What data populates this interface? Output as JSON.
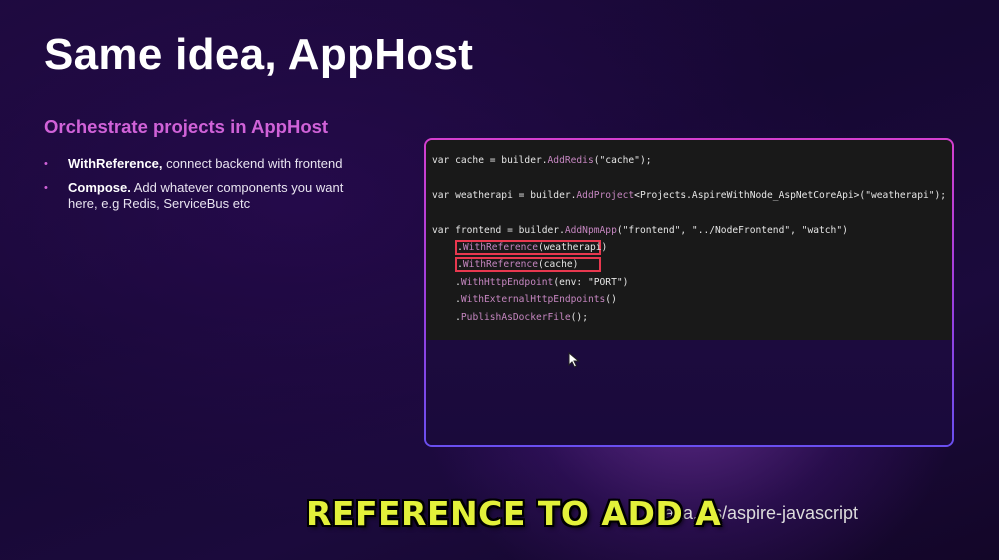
{
  "slide": {
    "title": "Same idea, AppHost",
    "subtitle": "Orchestrate projects in AppHost",
    "bullets": [
      {
        "bold": "WithReference,",
        "text": " connect backend with frontend"
      },
      {
        "bold": "Compose.",
        "text": " Add whatever components you want here, e.g Redis, ServiceBus etc"
      }
    ]
  },
  "code": {
    "lines": [
      [
        "var cache = builder.",
        "AddRedis",
        "(\"cache\");"
      ],
      [],
      [
        "var weatherapi = builder.",
        "AddProject",
        "<Projects.AspireWithNode_AspNetCoreApi>(\"weatherapi\");"
      ],
      [],
      [
        "var frontend = builder.",
        "AddNpmApp",
        "(\"frontend\", \"../NodeFrontend\", \"watch\")"
      ],
      [
        "    .",
        "WithReference",
        "(weatherapi)"
      ],
      [
        "    .",
        "WithReference",
        "(cache)"
      ],
      [
        "    .",
        "WithHttpEndpoint",
        "(env: \"PORT\")"
      ],
      [
        "    .",
        "WithExternalHttpEndpoints",
        "()"
      ],
      [
        "    .",
        "PublishAsDockerFile",
        "();"
      ]
    ],
    "highlighted_lines": [
      5,
      6
    ]
  },
  "footer": {
    "url": "aka.ms/aspire-javascript",
    "caption": "REFERENCE TO ADD A"
  },
  "colors": {
    "accent": "#d062d8",
    "highlight_box": "#e8384f",
    "caption": "#e3f13a"
  },
  "icons": {
    "pointer": "mouse-pointer-icon"
  }
}
